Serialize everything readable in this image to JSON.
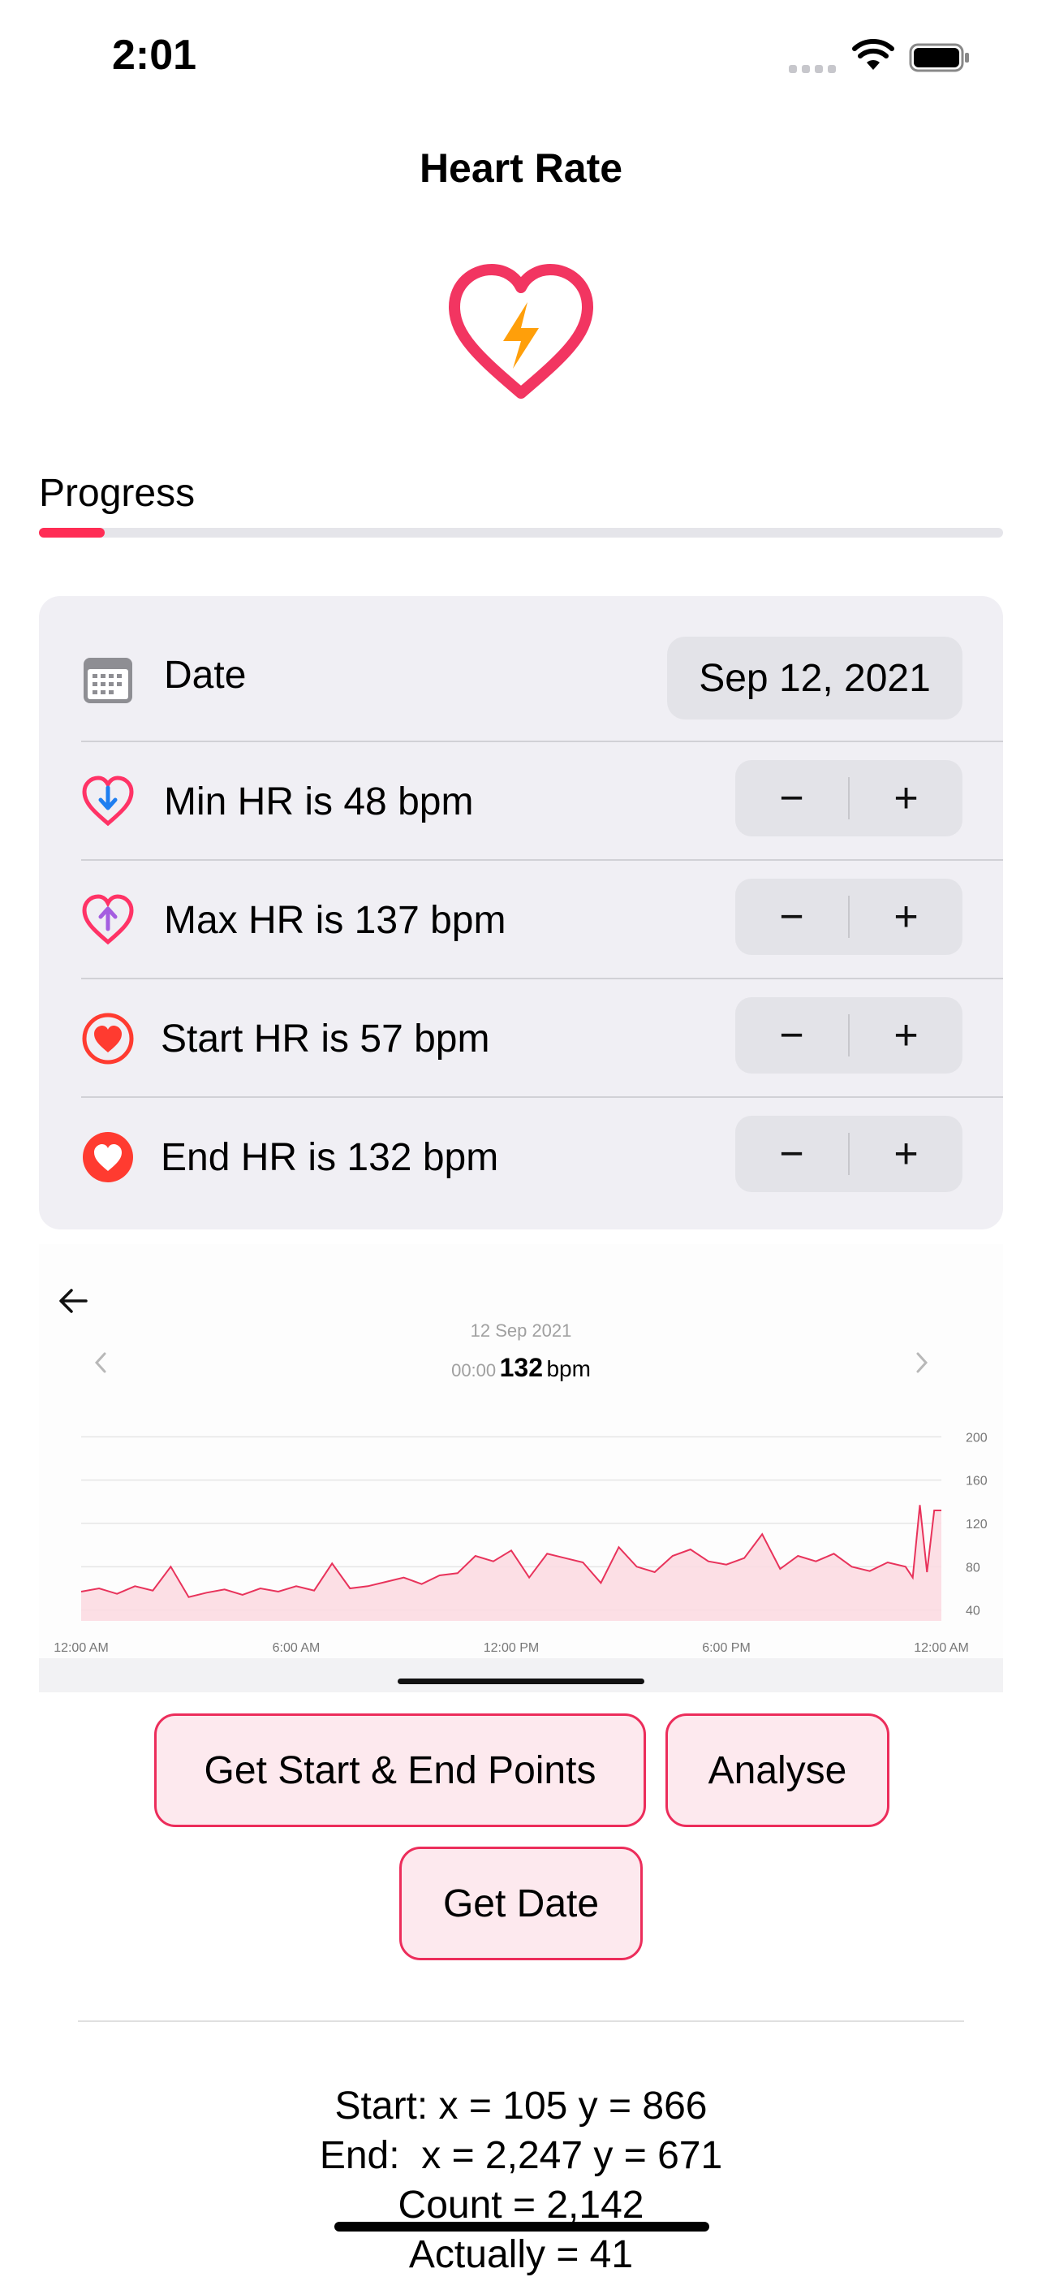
{
  "status": {
    "time": "2:01"
  },
  "nav": {
    "title": "Heart Rate"
  },
  "progress": {
    "label": "Progress",
    "value_fraction": 0.068
  },
  "form": {
    "date_label": "Date",
    "date_value": "Sep 12, 2021",
    "rows": [
      {
        "label": "Min HR is 48 bpm",
        "icon": "heart-arrow-down-icon"
      },
      {
        "label": "Max HR is 137 bpm",
        "icon": "heart-arrow-up-icon"
      },
      {
        "label": "Start HR is 57 bpm",
        "icon": "heart-circle-outline-icon"
      },
      {
        "label": "End HR is 132 bpm",
        "icon": "heart-circle-filled-icon"
      }
    ],
    "stepper": {
      "minus": "−",
      "plus": "+"
    }
  },
  "chart_panel": {
    "date": "12 Sep 2021",
    "time": "00:00",
    "value": "132",
    "unit": "bpm"
  },
  "chart_data": {
    "type": "area",
    "x_tick_labels": [
      "12:00 AM",
      "6:00 AM",
      "12:00 PM",
      "6:00 PM",
      "12:00 AM"
    ],
    "y_tick_labels": [
      "200",
      "160",
      "120",
      "80",
      "40"
    ],
    "ylim": [
      30,
      210
    ],
    "x": [
      0,
      0.5,
      1,
      1.5,
      2,
      2.5,
      3,
      3.5,
      4,
      4.5,
      5,
      5.5,
      6,
      6.5,
      7,
      7.5,
      8,
      8.5,
      9,
      9.5,
      10,
      10.5,
      11,
      11.5,
      12,
      12.5,
      13,
      13.5,
      14,
      14.5,
      15,
      15.5,
      16,
      16.5,
      17,
      17.5,
      18,
      18.5,
      19,
      19.5,
      20,
      20.5,
      21,
      21.5,
      22,
      22.5,
      23,
      23.2,
      23.4,
      23.6,
      23.8,
      24
    ],
    "y": [
      57,
      60,
      55,
      62,
      58,
      80,
      52,
      56,
      59,
      54,
      60,
      57,
      62,
      58,
      83,
      60,
      62,
      66,
      70,
      64,
      72,
      74,
      90,
      85,
      95,
      70,
      92,
      88,
      84,
      65,
      98,
      80,
      75,
      90,
      96,
      85,
      82,
      88,
      110,
      78,
      90,
      85,
      92,
      80,
      76,
      84,
      80,
      70,
      137,
      75,
      132,
      132
    ],
    "color": "#e8335b"
  },
  "buttons": {
    "get_start_end": "Get Start & End Points",
    "analyse": "Analyse",
    "get_date": "Get Date"
  },
  "results": {
    "start": "Start: x = 105 y = 866",
    "end": "End:  x = 2,247 y = 671",
    "count": "Count = 2,142",
    "actually": "Actually = 41"
  }
}
